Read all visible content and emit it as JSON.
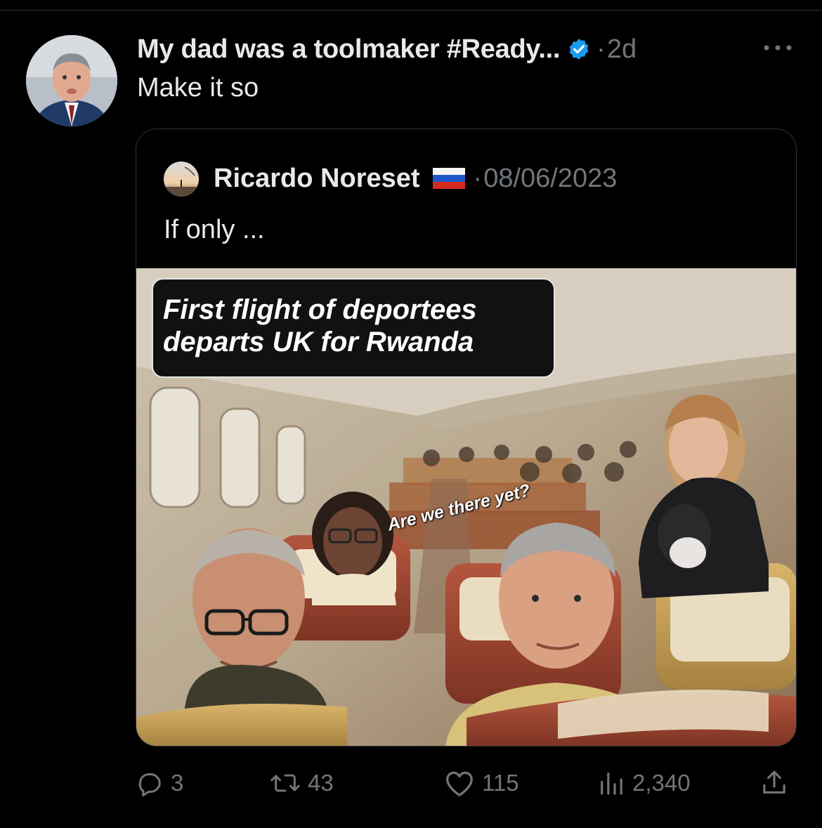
{
  "post": {
    "author_name": "My dad was a toolmaker #Ready...",
    "separator": "·",
    "time": "2d",
    "text": "Make it so"
  },
  "quoted": {
    "author_name": "Ricardo Noreset",
    "separator": "·",
    "date": "08/06/2023",
    "text": "If only ...",
    "image": {
      "caption_line1": "First flight of deportees",
      "caption_line2": "departs UK for Rwanda",
      "speech": "Are we there yet?"
    }
  },
  "actions": {
    "replies": "3",
    "reposts": "43",
    "likes": "115",
    "views": "2,340"
  },
  "colors": {
    "background": "#000000",
    "text_primary": "#e7e9ea",
    "text_secondary": "#71767b",
    "border": "#2f3336",
    "verified": "#1d9bf0"
  },
  "icons": [
    "verified-badge-icon",
    "more-icon",
    "russia-flag-icon",
    "reply-icon",
    "repost-icon",
    "like-icon",
    "views-icon",
    "share-icon"
  ]
}
